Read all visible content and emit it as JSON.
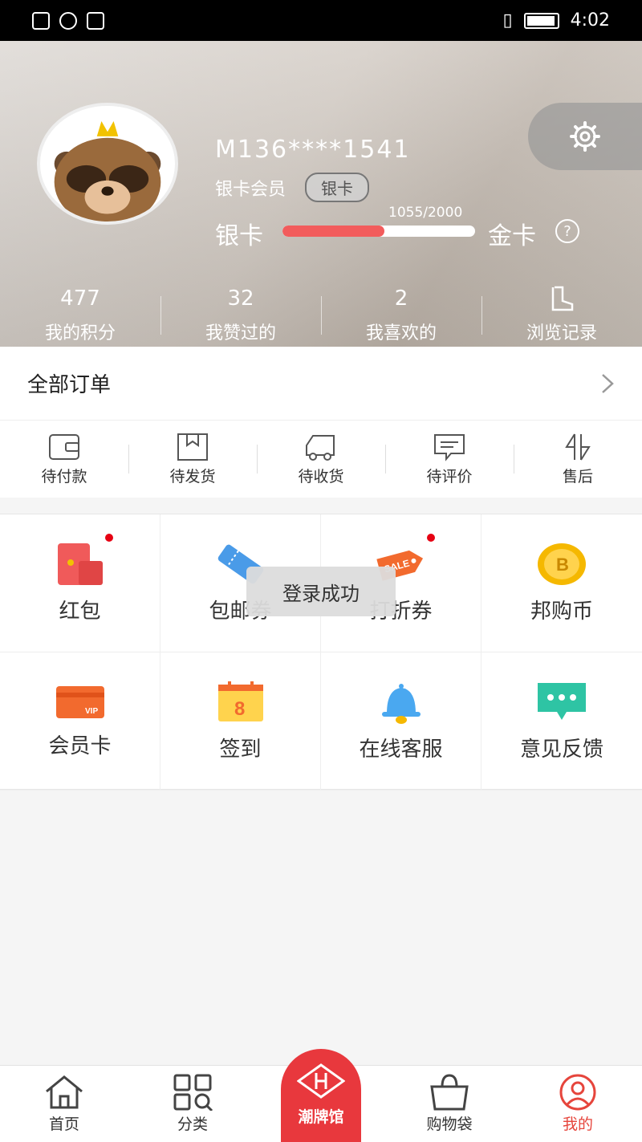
{
  "status_bar": {
    "time": "4:02"
  },
  "profile": {
    "username": "M136****1541",
    "member_level": "银卡会员",
    "level_badge": "银卡",
    "progress": {
      "from_label": "银卡",
      "to_label": "金卡",
      "current": 1055,
      "target": 2000,
      "count_text": "1055/2000",
      "fraction": 0.5275
    },
    "stats": [
      {
        "value": "477",
        "label": "我的积分"
      },
      {
        "value": "32",
        "label": "我赞过的"
      },
      {
        "value": "2",
        "label": "我喜欢的"
      },
      {
        "label": "浏览记录",
        "icon": "boot-icon"
      }
    ]
  },
  "orders": {
    "title": "全部订单",
    "items": [
      {
        "label": "待付款",
        "icon": "wallet-icon"
      },
      {
        "label": "待发货",
        "icon": "box-icon"
      },
      {
        "label": "待收货",
        "icon": "truck-icon"
      },
      {
        "label": "待评价",
        "icon": "comment-icon"
      },
      {
        "label": "售后",
        "icon": "exchange-icon"
      }
    ]
  },
  "services": [
    {
      "label": "红包",
      "icon": "red-envelope-icon",
      "dot": true
    },
    {
      "label": "包邮券",
      "icon": "ticket-icon",
      "dot": false
    },
    {
      "label": "打折券",
      "icon": "sale-tag-icon",
      "dot": true
    },
    {
      "label": "邦购币",
      "icon": "coin-icon",
      "dot": false
    },
    {
      "label": "会员卡",
      "icon": "vip-card-icon",
      "dot": false
    },
    {
      "label": "签到",
      "icon": "calendar-icon",
      "dot": false
    },
    {
      "label": "在线客服",
      "icon": "bell-icon",
      "dot": false
    },
    {
      "label": "意见反馈",
      "icon": "chat-bubble-icon",
      "dot": false
    }
  ],
  "toast": "登录成功",
  "tabbar": {
    "items": [
      {
        "label": "首页",
        "icon": "home-icon"
      },
      {
        "label": "分类",
        "icon": "category-icon"
      },
      {
        "label": "潮牌馆",
        "icon": "brand-icon"
      },
      {
        "label": "购物袋",
        "icon": "bag-icon"
      },
      {
        "label": "我的",
        "icon": "user-icon"
      }
    ],
    "active": "我的"
  },
  "colors": {
    "accent": "#e8383d",
    "progress": "#f25c5c"
  }
}
